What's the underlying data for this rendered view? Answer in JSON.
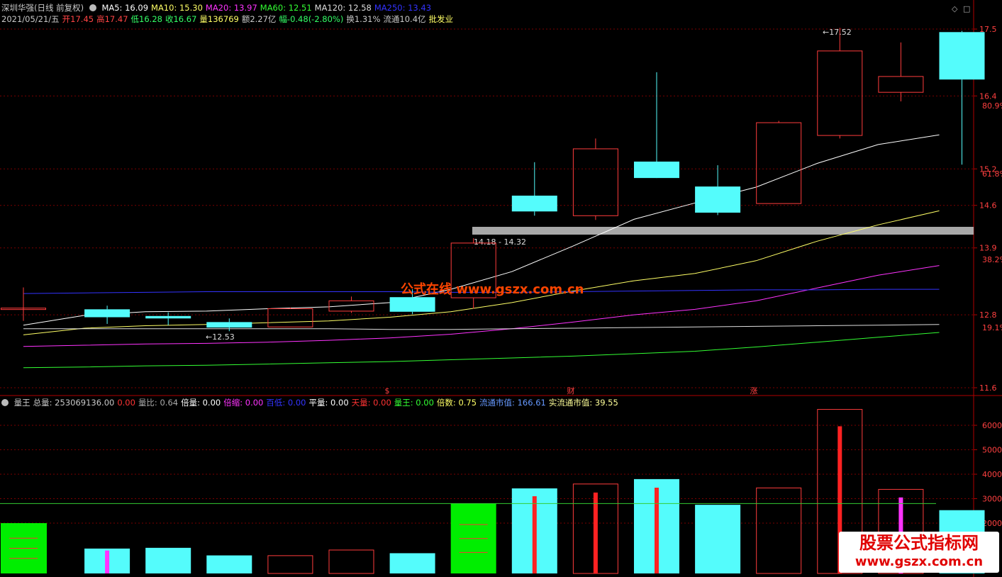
{
  "header": {
    "title": "深圳华强(日线 前复权)",
    "ma": [
      {
        "label": "MA5: 16.09",
        "color": "#ffffff"
      },
      {
        "label": "MA10: 15.30",
        "color": "#ffff66"
      },
      {
        "label": "MA20: 13.97",
        "color": "#ff33ff"
      },
      {
        "label": "MA60: 12.51",
        "color": "#33ff33"
      },
      {
        "label": "MA120: 12.58",
        "color": "#dddddd"
      },
      {
        "label": "MA250: 13.43",
        "color": "#3333ff"
      }
    ],
    "line2": [
      {
        "text": "2021/05/21/五",
        "color": "#c8c8c8"
      },
      {
        "text": "开17.45",
        "color": "#ff4444"
      },
      {
        "text": "高17.47",
        "color": "#ff4444"
      },
      {
        "text": "低16.28",
        "color": "#33ff66"
      },
      {
        "text": "收16.67",
        "color": "#33ff66"
      },
      {
        "text": "量136769",
        "color": "#ffff66"
      },
      {
        "text": "额2.27亿",
        "color": "#c8c8c8"
      },
      {
        "text": "幅-0.48(-2.80%)",
        "color": "#33ff66"
      },
      {
        "text": "换1.31%",
        "color": "#c8c8c8"
      },
      {
        "text": "流通10.4亿",
        "color": "#c8c8c8"
      },
      {
        "text": "批发业",
        "color": "#ffff66"
      }
    ]
  },
  "volume_header": [
    {
      "text": "量王",
      "color": "#c8c8c8"
    },
    {
      "text": "总量: 253069136.00",
      "color": "#c8c8c8"
    },
    {
      "text": "0.00",
      "color": "#ff3333"
    },
    {
      "text": "量比: 0.64",
      "color": "#aaaaaa"
    },
    {
      "text": "倍量: 0.00",
      "color": "#ffffff"
    },
    {
      "text": "倍缩: 0.00",
      "color": "#ff33ff"
    },
    {
      "text": "百低: 0.00",
      "color": "#3333ff"
    },
    {
      "text": "平量: 0.00",
      "color": "#ffffff"
    },
    {
      "text": "天量: 0.00",
      "color": "#ff3333"
    },
    {
      "text": "量王: 0.00",
      "color": "#33ff33"
    },
    {
      "text": "倍数: 0.75",
      "color": "#ffff66"
    },
    {
      "text": "流通市值: 166.61",
      "color": "#6699ff"
    },
    {
      "text": "实流通市值: 39.55",
      "color": "#ffff99"
    }
  ],
  "annotations": {
    "high_label": "17.52",
    "low_label": "12.53",
    "zone_label": "14.18 - 14.32",
    "markers": [
      "$",
      "财",
      "涨"
    ]
  },
  "watermark_center": "公式在线 www.gszx.com.cn",
  "watermark_corner": {
    "line1": "股票公式指标网",
    "line2": "www.gszx.com.cn"
  },
  "chart_data": {
    "type": "candlestick",
    "price_axis": {
      "ticks": [
        "17.5",
        "16.4",
        "15.2",
        "14.6",
        "13.9",
        "12.8",
        "11.6"
      ],
      "pct_ticks": [
        "80.9%",
        "61.8%",
        "38.2%",
        "19.1%"
      ],
      "ylim": [
        11.45,
        17.7
      ]
    },
    "candles": [
      {
        "o": 12.91,
        "h": 13.25,
        "l": 12.7,
        "c": 12.91
      },
      {
        "o": 12.89,
        "h": 12.95,
        "l": 12.65,
        "c": 12.76
      },
      {
        "o": 12.78,
        "h": 12.84,
        "l": 12.63,
        "c": 12.74
      },
      {
        "o": 12.68,
        "h": 12.74,
        "l": 12.53,
        "c": 12.59
      },
      {
        "o": 12.6,
        "h": 12.92,
        "l": 12.6,
        "c": 12.9
      },
      {
        "o": 12.86,
        "h": 13.1,
        "l": 12.83,
        "c": 13.03
      },
      {
        "o": 13.09,
        "h": 13.22,
        "l": 12.81,
        "c": 12.85
      },
      {
        "o": 13.08,
        "h": 14.06,
        "l": 12.9,
        "c": 13.98
      },
      {
        "o": 14.76,
        "h": 15.31,
        "l": 14.43,
        "c": 14.5
      },
      {
        "o": 14.43,
        "h": 15.7,
        "l": 14.36,
        "c": 15.53
      },
      {
        "o": 15.32,
        "h": 16.79,
        "l": 15.1,
        "c": 15.05
      },
      {
        "o": 14.91,
        "h": 15.26,
        "l": 14.44,
        "c": 14.48
      },
      {
        "o": 14.63,
        "h": 15.99,
        "l": 14.63,
        "c": 15.96
      },
      {
        "o": 15.75,
        "h": 17.52,
        "l": 15.7,
        "c": 17.14
      },
      {
        "o": 16.46,
        "h": 17.28,
        "l": 16.31,
        "c": 16.72
      },
      {
        "o": 17.45,
        "h": 17.47,
        "l": 15.27,
        "c": 16.67
      }
    ],
    "ma_series": [
      {
        "name": "MA5",
        "color": "#ffffff",
        "values": [
          12.63,
          12.79,
          12.85,
          12.86,
          12.9,
          12.93,
          13.0,
          13.22,
          13.51,
          13.93,
          14.37,
          14.64,
          14.9,
          15.29,
          15.6,
          15.76
        ]
      },
      {
        "name": "MA10",
        "color": "#ffff66",
        "values": [
          12.47,
          12.58,
          12.62,
          12.64,
          12.67,
          12.7,
          12.76,
          12.85,
          13.0,
          13.19,
          13.36,
          13.48,
          13.69,
          14.01,
          14.28,
          14.51
        ]
      },
      {
        "name": "MA20",
        "color": "#ff33ff",
        "values": [
          12.28,
          12.3,
          12.32,
          12.33,
          12.35,
          12.38,
          12.42,
          12.48,
          12.57,
          12.68,
          12.8,
          12.89,
          13.03,
          13.24,
          13.45,
          13.61
        ]
      },
      {
        "name": "MA60",
        "color": "#33ff33",
        "values": [
          11.93,
          11.94,
          11.96,
          11.97,
          11.99,
          12.01,
          12.03,
          12.06,
          12.09,
          12.12,
          12.16,
          12.2,
          12.27,
          12.35,
          12.43,
          12.51
        ]
      },
      {
        "name": "MA120",
        "color": "#dddddd",
        "values": [
          12.57,
          12.57,
          12.57,
          12.57,
          12.57,
          12.57,
          12.56,
          12.56,
          12.57,
          12.58,
          12.59,
          12.6,
          12.61,
          12.62,
          12.63,
          12.64
        ]
      },
      {
        "name": "MA250",
        "color": "#3333ff",
        "values": [
          13.15,
          13.16,
          13.17,
          13.18,
          13.18,
          13.18,
          13.18,
          13.17,
          13.17,
          13.18,
          13.19,
          13.2,
          13.21,
          13.21,
          13.22,
          13.22
        ]
      }
    ],
    "zone": {
      "low": 14.18,
      "high": 14.32
    },
    "volume_axis": {
      "ticks": [
        "6000",
        "5000",
        "4000",
        "3000",
        "2000"
      ],
      "ylim": [
        0,
        6800
      ]
    },
    "volume": [
      {
        "v": 2000,
        "style": "green"
      },
      {
        "v": 960,
        "style": "cyan",
        "inner": 880,
        "inner_color": "#ff33ff"
      },
      {
        "v": 990,
        "style": "cyan"
      },
      {
        "v": 680,
        "style": "cyan"
      },
      {
        "v": 670,
        "style": "red"
      },
      {
        "v": 900,
        "style": "red"
      },
      {
        "v": 770,
        "style": "cyan"
      },
      {
        "v": 2800,
        "style": "green"
      },
      {
        "v": 3420,
        "style": "cyan",
        "inner": 3100,
        "inner_color": "#ff2222"
      },
      {
        "v": 3600,
        "style": "red",
        "inner": 3250,
        "inner_color": "#ff2222"
      },
      {
        "v": 3800,
        "style": "cyan",
        "inner": 3450,
        "inner_color": "#ff2222"
      },
      {
        "v": 2750,
        "style": "cyan"
      },
      {
        "v": 3440,
        "style": "red"
      },
      {
        "v": 6650,
        "style": "red",
        "inner": 5960,
        "inner_color": "#ff2222"
      },
      {
        "v": 3380,
        "style": "red",
        "inner": 3050,
        "inner_color": "#ff33ff"
      },
      {
        "v": 2530,
        "style": "cyan"
      }
    ],
    "volume_ref": 2800
  }
}
